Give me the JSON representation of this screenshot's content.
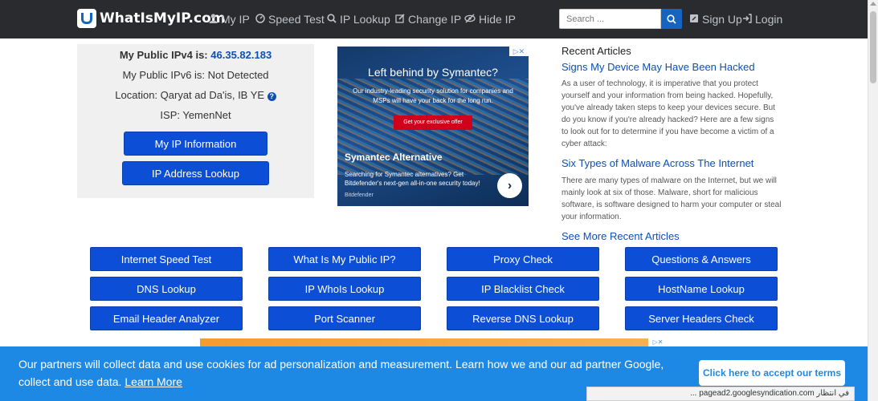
{
  "navbar": {
    "logo_text": "WhatIsMyIP.com",
    "items": [
      {
        "label": "My IP",
        "icon": "user-icon"
      },
      {
        "label": "Speed Test",
        "icon": "dashboard-icon"
      },
      {
        "label": "IP Lookup",
        "icon": "search-icon"
      },
      {
        "label": "Change IP",
        "icon": "edit-icon"
      },
      {
        "label": "Hide IP",
        "icon": "eye-slash-icon"
      }
    ],
    "search_placeholder": "Search ...",
    "signup_label": "Sign Up",
    "login_label": "Login"
  },
  "ip_info": {
    "ipv4_label": "My Public IPv4 is:",
    "ipv4_value": "46.35.82.183",
    "ipv6_text": "My Public IPv6 is: Not Detected",
    "location_text": "Location: Qaryat ad Da'is, IB YE",
    "isp_text": "ISP: YemenNet",
    "btn_info": "My IP Information",
    "btn_lookup": "IP Address Lookup"
  },
  "ad": {
    "title": "Left behind by Symantec?",
    "subtitle": "Our industry-leading security solution for companies and MSPs will have your back for the long run.",
    "cta": "Get your exclusive offer",
    "heading": "Symantec Alternative",
    "text": "Searching for Symantec alternatives? Get Bitdefender's next-gen all-in-one security today!",
    "brand": "Bitdefender"
  },
  "recent_articles": {
    "title": "Recent Articles",
    "items": [
      {
        "title": "Signs My Device May Have Been Hacked",
        "body": "As a user of technology, it is imperative that you protect yourself and your information from being hacked. Hopefully, you've already taken steps to keep your devices secure. But do you know if you're already hacked? Here are a few signs to look out for to determine if you have become a victim of a cyber attack:"
      },
      {
        "title": "Six Types of Malware Across The Internet",
        "body": "There are many types of malware on the Internet, but we will mainly look at six of those.  Malware, short for malicious software, is software designed to harm your computer or steal your information."
      }
    ],
    "see_more": "See More Recent Articles"
  },
  "tools": [
    [
      "Internet Speed Test",
      "What Is My Public IP?",
      "Proxy Check",
      "Questions & Answers"
    ],
    [
      "DNS Lookup",
      "IP WhoIs Lookup",
      "IP Blacklist Check",
      "HostName Lookup"
    ],
    [
      "Email Header Analyzer",
      "Port Scanner",
      "Reverse DNS Lookup",
      "Server Headers Check"
    ]
  ],
  "cookie": {
    "text": "Our partners will collect data and use cookies for ad personalization and measurement. Learn how we and our ad partner Google, collect and use data.",
    "learn_more": "Learn More",
    "accept": "Click here to accept our terms"
  },
  "status_bar": "في انتظار pagead2.googlesyndication.com ..."
}
